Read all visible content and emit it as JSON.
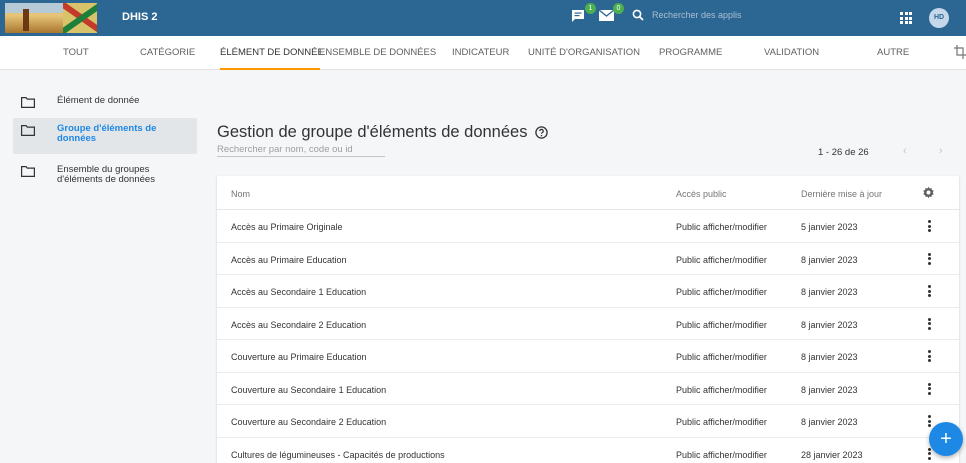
{
  "header": {
    "title": "DHIS 2",
    "interpretations_badge": "1",
    "messages_badge": "0",
    "search_placeholder": "Rechercher des applis",
    "avatar_initials": "HD",
    "bar_color": "#2c6693"
  },
  "tabs": [
    {
      "label": "TOUT"
    },
    {
      "label": "CATÉGORIE"
    },
    {
      "label": "ÉLÉMENT DE DONNÉE"
    },
    {
      "label": "ENSEMBLE DE DONNÉES"
    },
    {
      "label": "INDICATEUR"
    },
    {
      "label": "UNITÉ D'ORGANISATION"
    },
    {
      "label": "PROGRAMME"
    },
    {
      "label": "VALIDATION"
    },
    {
      "label": "AUTRE"
    }
  ],
  "sidebar": {
    "items": [
      {
        "label": "Élément de donnée",
        "icon": "folder-icon"
      },
      {
        "label": "Groupe d'éléments de données",
        "icon": "folder-icon",
        "active": true
      },
      {
        "label": "Ensemble du groupes d'éléments de données",
        "icon": "folder-icon"
      }
    ]
  },
  "main": {
    "title": "Gestion de groupe d'éléments de données",
    "search_placeholder": "Rechercher par nom, code ou id",
    "pager": "1 - 26 de 26",
    "columns": {
      "name": "Nom",
      "public_access": "Accès public",
      "last_updated": "Dernière mise à jour"
    },
    "rows": [
      {
        "name": "Accès au Primaire Originale",
        "access": "Public afficher/modifier",
        "updated": "5 janvier 2023"
      },
      {
        "name": "Accès au Primaire Education",
        "access": "Public afficher/modifier",
        "updated": "8 janvier 2023"
      },
      {
        "name": "Accès au Secondaire 1 Education",
        "access": "Public afficher/modifier",
        "updated": "8 janvier 2023"
      },
      {
        "name": "Accès au Secondaire 2 Education",
        "access": "Public afficher/modifier",
        "updated": "8 janvier 2023"
      },
      {
        "name": "Couverture au Primaire Education",
        "access": "Public afficher/modifier",
        "updated": "8 janvier 2023"
      },
      {
        "name": "Couverture au Secondaire 1 Education",
        "access": "Public afficher/modifier",
        "updated": "8 janvier 2023"
      },
      {
        "name": "Couverture au Secondaire 2 Education",
        "access": "Public afficher/modifier",
        "updated": "8 janvier 2023"
      },
      {
        "name": "Cultures de légumineuses - Capacités de productions",
        "access": "Public afficher/modifier",
        "updated": "28 janvier 2023"
      }
    ]
  },
  "fab": {
    "label": "+"
  },
  "colors": {
    "accent": "#1e88e5",
    "tab_indicator": "#ff9800"
  }
}
